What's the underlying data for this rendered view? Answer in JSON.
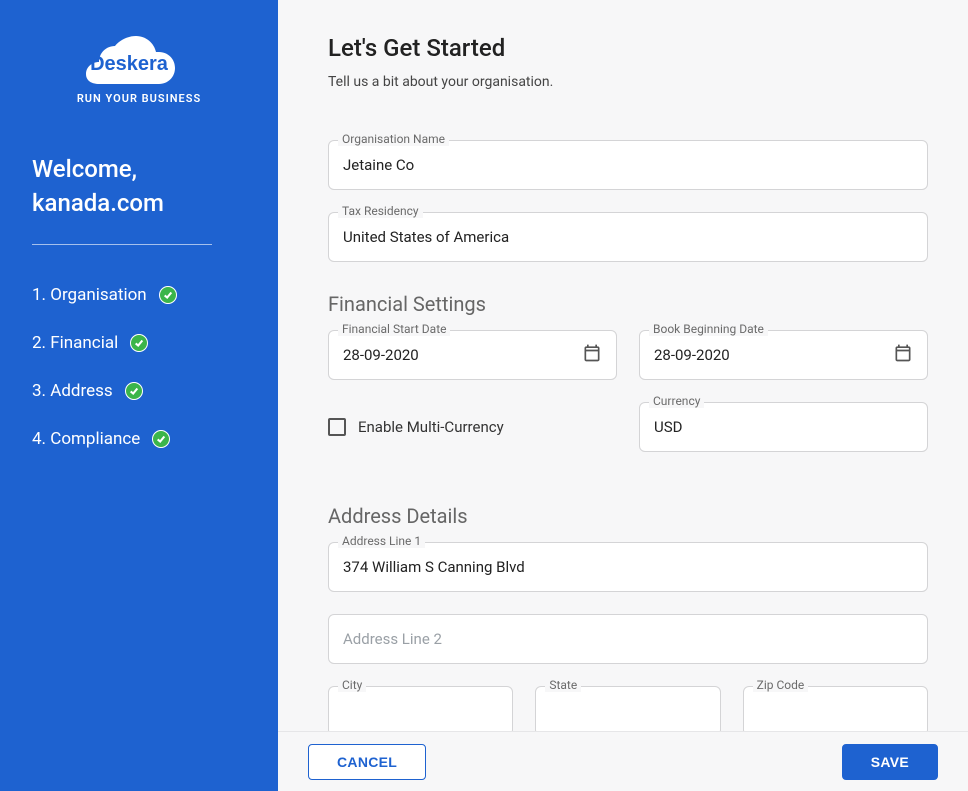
{
  "sidebar": {
    "brand": "Deskera",
    "tagline": "RUN YOUR BUSINESS",
    "welcome_line1": "Welcome,",
    "welcome_line2": "kanada.com",
    "steps": [
      {
        "label": "1. Organisation"
      },
      {
        "label": "2. Financial"
      },
      {
        "label": "3. Address"
      },
      {
        "label": "4. Compliance"
      }
    ]
  },
  "header": {
    "title": "Let's Get Started",
    "subtitle": "Tell us a bit about your organisation."
  },
  "org": {
    "name_label": "Organisation Name",
    "name_value": "Jetaine Co",
    "tax_label": "Tax Residency",
    "tax_value": "United States of America"
  },
  "financial": {
    "section_title": "Financial Settings",
    "start_label": "Financial Start Date",
    "start_value": "28-09-2020",
    "book_label": "Book Beginning Date",
    "book_value": "28-09-2020",
    "multi_label": "Enable Multi-Currency",
    "currency_label": "Currency",
    "currency_value": "USD"
  },
  "address": {
    "section_title": "Address Details",
    "line1_label": "Address Line 1",
    "line1_value": "374 William S Canning Blvd",
    "line2_placeholder": "Address Line 2",
    "city_label": "City",
    "state_label": "State",
    "zip_label": "Zip Code"
  },
  "footer": {
    "cancel": "CANCEL",
    "save": "SAVE"
  }
}
